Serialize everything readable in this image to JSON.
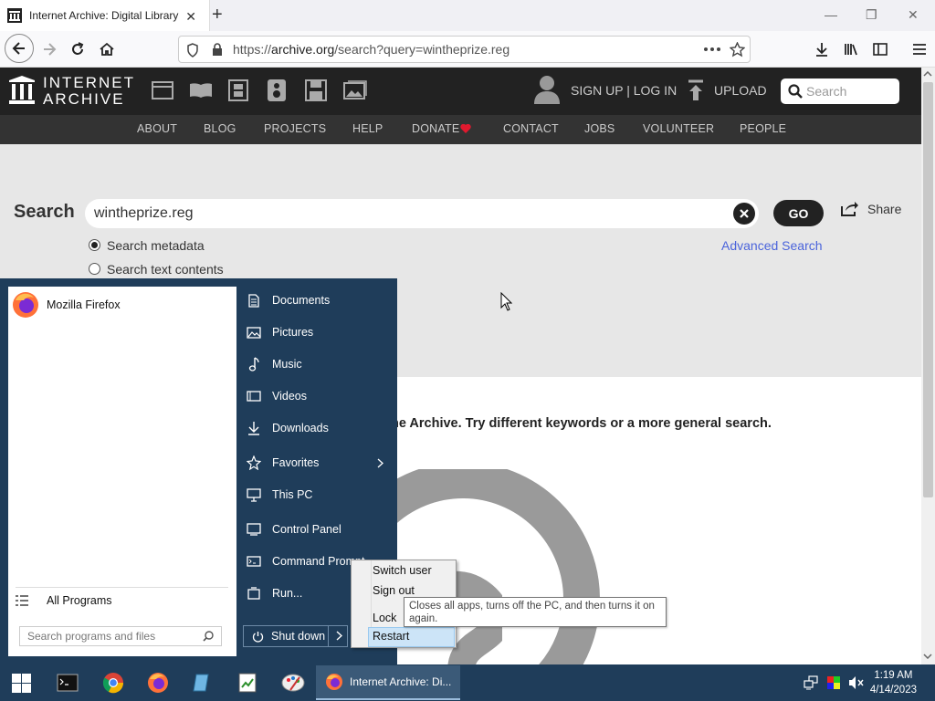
{
  "browser": {
    "tab_title": "Internet Archive: Digital Library",
    "tab_close": "✕",
    "new_tab": "+",
    "url_prefix": "https://",
    "url_host": "archive.org",
    "url_path": "/search?query=wintheprize.reg",
    "window_min": "—",
    "window_restore": "❐",
    "window_close": "✕"
  },
  "ia_header": {
    "logo_line1": "INTERNET",
    "logo_line2": "ARCHIVE",
    "signup_login": "SIGN UP | LOG IN",
    "upload": "UPLOAD",
    "search_placeholder": "Search",
    "nav": [
      "ABOUT",
      "BLOG",
      "PROJECTS",
      "HELP",
      "DONATE",
      "CONTACT",
      "JOBS",
      "VOLUNTEER",
      "PEOPLE"
    ]
  },
  "search": {
    "label": "Search",
    "query": "wintheprize.reg",
    "go": "GO",
    "share": "Share",
    "option_metadata": "Search metadata",
    "option_text": "Search text contents",
    "advanced": "Advanced Search",
    "no_results": "he Archive. Try different keywords or a more general search."
  },
  "start_menu": {
    "pinned": "Mozilla Firefox",
    "all_programs": "All Programs",
    "search_placeholder": "Search programs and files",
    "items": [
      "Documents",
      "Pictures",
      "Music",
      "Videos",
      "Downloads",
      "Favorites",
      "This PC",
      "Control Panel",
      "Command Prompt",
      "Run..."
    ],
    "shutdown": "Shut down",
    "context": [
      "Switch user",
      "Sign out",
      "Lock",
      "Restart"
    ],
    "tooltip": "Closes all apps, turns off the PC, and then turns it on again."
  },
  "taskbar": {
    "window_title": "Internet Archive: Di...",
    "time": "1:19 AM",
    "date": "4/14/2023"
  },
  "colors": {
    "accent_blue": "#4b64db",
    "start_menu_bg": "#1f3d5a",
    "donate_heart": "#e0192e"
  }
}
